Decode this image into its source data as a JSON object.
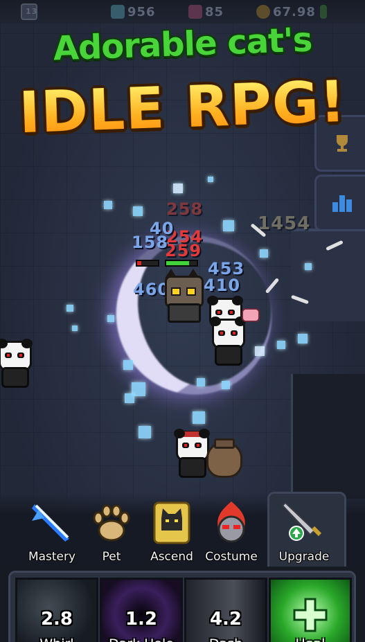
{
  "hud": {
    "level": "13",
    "gems": "956",
    "hearts": "85",
    "gold": "67.98"
  },
  "headline": {
    "line1": "Adorable cat's",
    "line2": "IDLE RPG!"
  },
  "side_buttons": [
    {
      "icon": "trophy-icon"
    },
    {
      "icon": "ranking-bars-icon"
    }
  ],
  "damage_numbers": {
    "red": [
      "258",
      "254",
      "259"
    ],
    "blue": [
      "40",
      "158",
      "453",
      "460",
      "410"
    ],
    "gold": [
      "1454"
    ]
  },
  "menu": [
    {
      "label": "Mastery",
      "icon": "blue-sword-slash-icon"
    },
    {
      "label": "Pet",
      "icon": "paw-icon"
    },
    {
      "label": "Ascend",
      "icon": "golden-cat-icon"
    },
    {
      "label": "Costume",
      "icon": "flaming-helmet-icon"
    },
    {
      "label": "Upgrade",
      "icon": "sword-upgrade-icon"
    }
  ],
  "skills": [
    {
      "cooldown": "2.8",
      "name": "Whirl",
      "color": "#3a4a5a"
    },
    {
      "cooldown": "1.2",
      "name": "Dark Hole",
      "color": "#4a2a6e"
    },
    {
      "cooldown": "4.2",
      "name": "Dash",
      "color": "#3c4150"
    },
    {
      "cooldown": "",
      "name": "Heal",
      "color": "#2aa82a"
    }
  ],
  "colors": {
    "title_green": "#49d53a",
    "title_gold": "#ffc23d",
    "damage_red": "#e23a3a",
    "damage_blue": "#7aa6e8",
    "hp_red": "#d22a2a",
    "hp_green": "#3fd23a"
  },
  "enemy_hp_fraction": 0.2,
  "player_hp_fraction": 0.75
}
